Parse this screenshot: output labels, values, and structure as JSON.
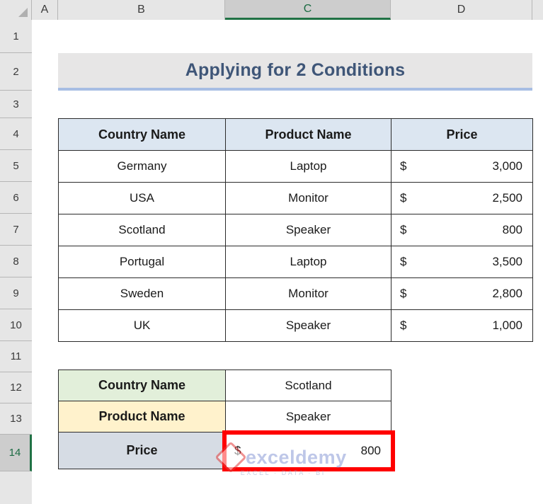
{
  "app": {
    "type": "spreadsheet",
    "selected_column": "C",
    "selected_row": "14",
    "active_cell": "C14"
  },
  "grid": {
    "column_headers": [
      "A",
      "B",
      "C",
      "D"
    ],
    "row_headers": [
      "1",
      "2",
      "3",
      "4",
      "5",
      "6",
      "7",
      "8",
      "9",
      "10",
      "11",
      "12",
      "13",
      "14"
    ],
    "select_all_icon": "select-all-triangle-icon"
  },
  "title": {
    "text": "Applying for 2 Conditions"
  },
  "main_table": {
    "headers": [
      "Country Name",
      "Product Name",
      "Price"
    ],
    "rows": [
      {
        "country": "Germany",
        "product": "Laptop",
        "currency": "$",
        "price": "3,000"
      },
      {
        "country": "USA",
        "product": "Monitor",
        "currency": "$",
        "price": "2,500"
      },
      {
        "country": "Scotland",
        "product": "Speaker",
        "currency": "$",
        "price": "800"
      },
      {
        "country": "Portugal",
        "product": "Laptop",
        "currency": "$",
        "price": "3,500"
      },
      {
        "country": "Sweden",
        "product": "Monitor",
        "currency": "$",
        "price": "2,800"
      },
      {
        "country": "UK",
        "product": "Speaker",
        "currency": "$",
        "price": "1,000"
      }
    ]
  },
  "lookup_table": {
    "rows": [
      {
        "label": "Country Name",
        "value": "Scotland"
      },
      {
        "label": "Product Name",
        "value": "Speaker"
      }
    ],
    "result": {
      "label": "Price",
      "currency": "$",
      "value": "800"
    }
  },
  "watermark": {
    "name": "exceldemy",
    "tagline": "EXCEL  ·  DATA  ·  BI",
    "logo": "exceldemy-logo-icon"
  },
  "colors": {
    "header_fill": "#DCE6F1",
    "title_fill": "#E7E6E6",
    "title_text": "#3F5678",
    "title_underline": "#A7BDE3",
    "label_green": "#E2EFDA",
    "label_yellow": "#FFF2CC",
    "label_gray": "#D6DCE4",
    "highlight_red": "#FF0000",
    "selection_green": "#207245"
  }
}
